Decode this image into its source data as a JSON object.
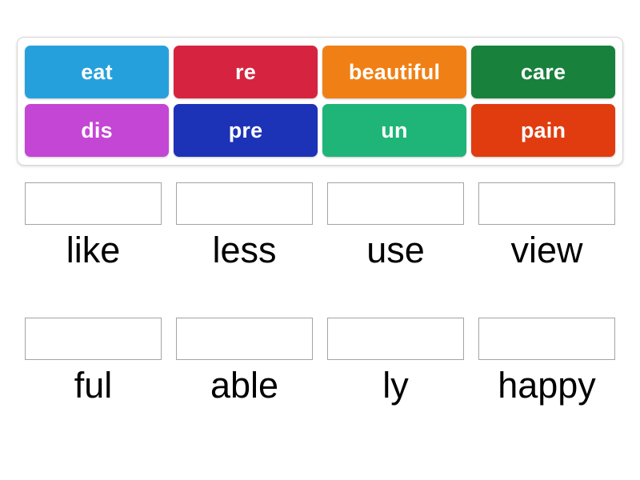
{
  "activity": {
    "type": "drag-and-drop-word-match",
    "background_color": "#ffffff"
  },
  "tile_tray": {
    "border_color": "#d6d6d6",
    "rows": [
      [
        {
          "label": "eat",
          "color": "#26a0dd"
        },
        {
          "label": "re",
          "color": "#d62440"
        },
        {
          "label": "beautiful",
          "color": "#f08015"
        },
        {
          "label": "care",
          "color": "#18813c"
        }
      ],
      [
        {
          "label": "dis",
          "color": "#c446d4"
        },
        {
          "label": "pre",
          "color": "#1c33b8"
        },
        {
          "label": "un",
          "color": "#1fb578"
        },
        {
          "label": "pain",
          "color": "#e03c10"
        }
      ]
    ]
  },
  "answer_grid": {
    "drop_zone_border_color": "#a3a3a3",
    "label_color": "#000000",
    "rows": [
      [
        {
          "word": "like",
          "answer": ""
        },
        {
          "word": "less",
          "answer": ""
        },
        {
          "word": "use",
          "answer": ""
        },
        {
          "word": "view",
          "answer": ""
        }
      ],
      [
        {
          "word": "ful",
          "answer": ""
        },
        {
          "word": "able",
          "answer": ""
        },
        {
          "word": "ly",
          "answer": ""
        },
        {
          "word": "happy",
          "answer": ""
        }
      ]
    ]
  }
}
